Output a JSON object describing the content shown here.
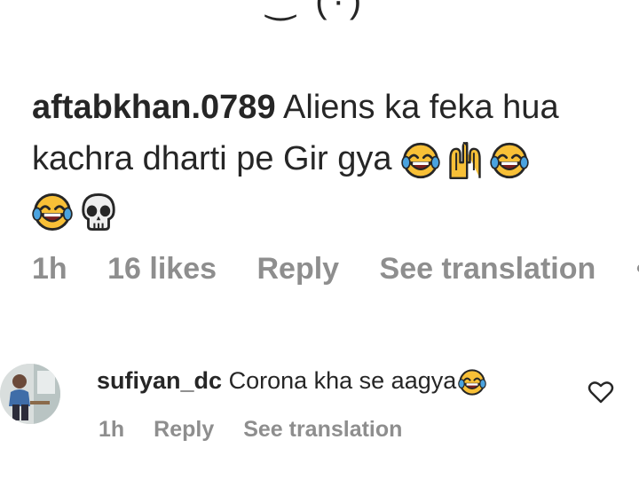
{
  "main_comment": {
    "username": "aftabkhan.0789",
    "text_line1": "Aliens ka feka hua",
    "text_line2": "kachra dharti pe Gir gya",
    "emojis_line2": [
      "face-with-tears-of-joy",
      "raising-hands",
      "face-with-tears-of-joy"
    ],
    "emojis_line3": [
      "face-with-tears-of-joy",
      "skull"
    ],
    "time": "1h",
    "likes": "16 likes",
    "reply_label": "Reply",
    "translate_label": "See translation",
    "more_label": "••"
  },
  "reply_comment": {
    "username": "sufiyan_dc",
    "text": "Corona kha se aagya",
    "emoji": "face-with-tears-of-joy",
    "time": "1h",
    "reply_label": "Reply",
    "translate_label": "See translation",
    "like_icon": "heart-outline-icon"
  },
  "colors": {
    "text": "#262626",
    "secondary": "#8e8e8e",
    "emoji_face": "#f8c037",
    "emoji_tear": "#4aa3df"
  }
}
